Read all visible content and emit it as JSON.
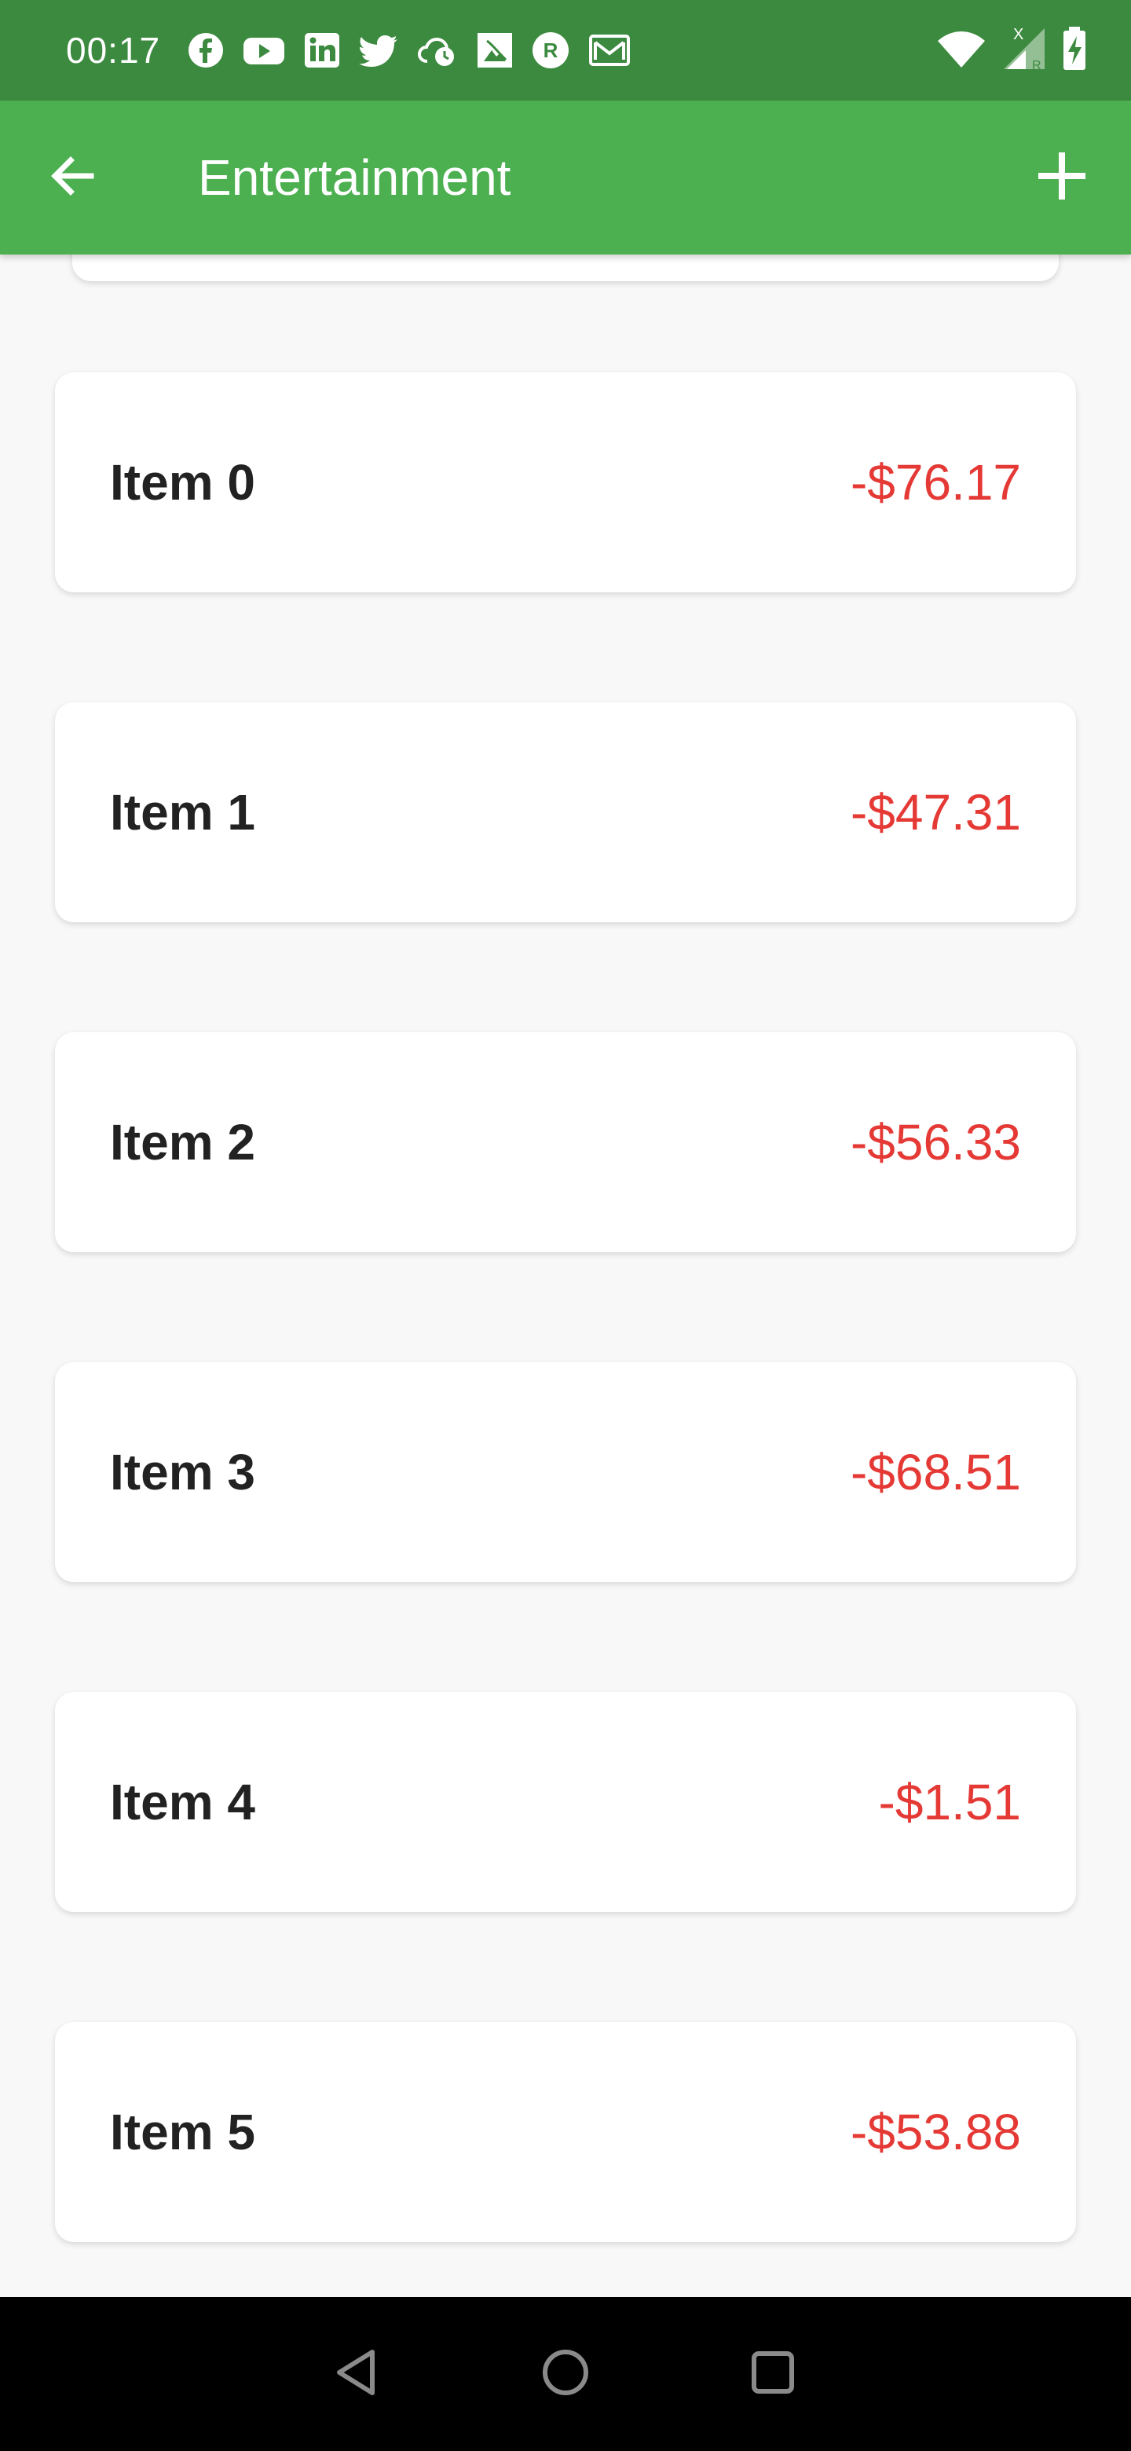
{
  "status_bar": {
    "time": "00:17",
    "icons_left": [
      "facebook-icon",
      "youtube-icon",
      "linkedin-icon",
      "twitter-icon",
      "cloud-clock-icon",
      "photo-icon",
      "r-icon",
      "mail-icon"
    ],
    "icons_right": [
      "wifi-icon",
      "cell-signal-icon",
      "battery-charging-icon"
    ],
    "color": "#3c8a3f"
  },
  "app_bar": {
    "title": "Entertainment",
    "back_icon": "arrow-back-icon",
    "add_icon": "plus-icon",
    "color": "#4caf50"
  },
  "items": [
    {
      "name": "Item 0",
      "amount": "-$76.17"
    },
    {
      "name": "Item 1",
      "amount": "-$47.31"
    },
    {
      "name": "Item 2",
      "amount": "-$56.33"
    },
    {
      "name": "Item 3",
      "amount": "-$68.51"
    },
    {
      "name": "Item 4",
      "amount": "-$1.51"
    },
    {
      "name": "Item 5",
      "amount": "-$53.88"
    }
  ],
  "colors": {
    "amount": "#e53935",
    "background": "#f8f8f8"
  },
  "nav_bar": {
    "icons": [
      "back-triangle-icon",
      "home-circle-icon",
      "recents-square-icon"
    ]
  }
}
